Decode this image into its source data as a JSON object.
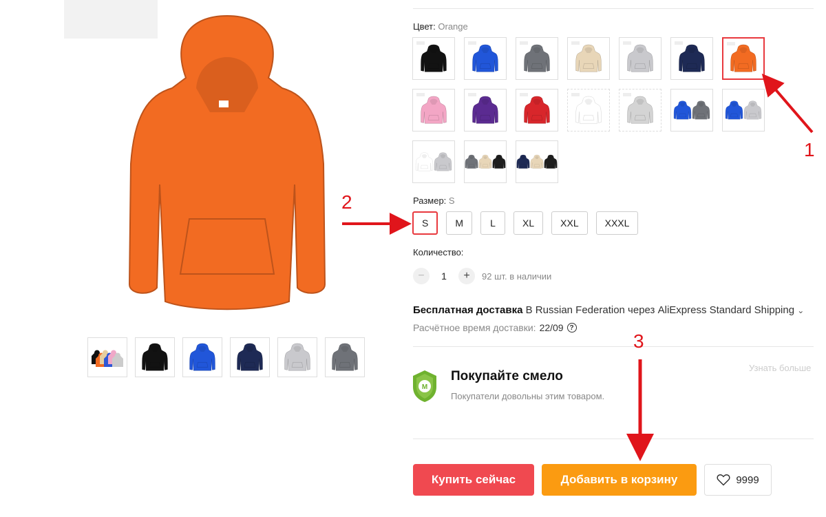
{
  "product": {
    "main_image_color": "#f26b22",
    "thumbnails": [
      {
        "icon": "hoodie-collection-icon",
        "colors": [
          "#111111",
          "#f26b22",
          "#e6ce9e",
          "#2e57d6",
          "#f0a8c8",
          "#cccccc"
        ]
      },
      {
        "icon": "hoodie-icon",
        "color": "#121212"
      },
      {
        "icon": "hoodie-icon",
        "color": "#2156d9"
      },
      {
        "icon": "hoodie-icon",
        "color": "#1e2a55"
      },
      {
        "icon": "hoodie-icon",
        "color": "#c9c9cd"
      },
      {
        "icon": "hoodie-icon",
        "color": "#6f7278"
      }
    ]
  },
  "color_option": {
    "label": "Цвет:",
    "selected_value": "Orange",
    "swatches": [
      {
        "colors": [
          "#121212"
        ]
      },
      {
        "colors": [
          "#2156d9"
        ]
      },
      {
        "colors": [
          "#6f7278"
        ]
      },
      {
        "colors": [
          "#e8d6b8"
        ]
      },
      {
        "colors": [
          "#c9c9cd"
        ]
      },
      {
        "colors": [
          "#1e2a55"
        ]
      },
      {
        "colors": [
          "#f26b22"
        ],
        "selected": true
      },
      {
        "colors": [
          "#f3a6c5"
        ]
      },
      {
        "colors": [
          "#5b2b91"
        ]
      },
      {
        "colors": [
          "#d8262b"
        ]
      },
      {
        "colors": [
          "#ffffff"
        ],
        "dashed": true
      },
      {
        "colors": [
          "#d4d4d4"
        ],
        "dashed": true
      },
      {
        "colors": [
          "#2156d9",
          "#6f7278"
        ]
      },
      {
        "colors": [
          "#2156d9",
          "#c9c9cd"
        ]
      },
      {
        "colors": [
          "#ffffff",
          "#c9c9cd"
        ]
      },
      {
        "colors": [
          "#6f7278",
          "#e8d6b8",
          "#1e1e1e"
        ]
      },
      {
        "colors": [
          "#1e2a55",
          "#e8d6b8",
          "#1e1e1e"
        ]
      }
    ]
  },
  "size_option": {
    "label": "Размер:",
    "selected_value": "S",
    "sizes": [
      "S",
      "M",
      "L",
      "XL",
      "XXL",
      "XXXL"
    ]
  },
  "quantity": {
    "label": "Количество:",
    "minus": "−",
    "plus": "+",
    "value": "1",
    "stock_text": "92 шт. в наличии"
  },
  "delivery": {
    "free_label": "Бесплатная доставка",
    "details": " В Russian Federation через AliExpress Standard Shipping",
    "chevron": "⌄",
    "eta_label": "Расчётное время доставки:",
    "eta_date": "22/09",
    "help_icon": "?"
  },
  "buyer_protection": {
    "learn_more": "Узнать больше",
    "title": "Покупайте смело",
    "subtitle": "Покупатели довольны этим товаром.",
    "shield_color": "#6fb22f"
  },
  "actions": {
    "buy_now": "Купить сейчас",
    "add_to_cart": "Добавить в корзину",
    "wishlist_count": "9999",
    "buy_color": "#f04950",
    "cart_color": "#fb9b11"
  },
  "annotations": {
    "one": "1",
    "two": "2",
    "three": "3",
    "color": "#e0151b"
  }
}
